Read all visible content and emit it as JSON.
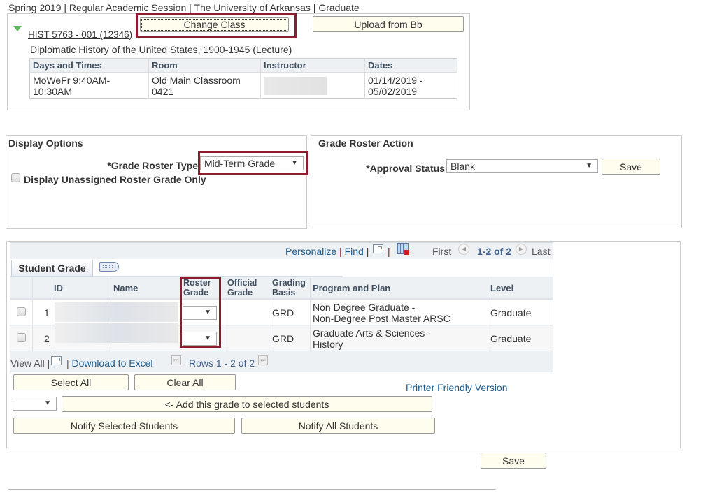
{
  "header": {
    "term_line": "Spring 2019 | Regular Academic Session | The University of Arkansas | Graduate"
  },
  "class_section": {
    "change_class_label": "Change Class",
    "upload_label": "Upload from Bb",
    "class_link": "HIST 5763 - 001 (12346)",
    "class_title": "Diplomatic History of the United States, 1900-1945 (Lecture)",
    "table": {
      "headers": [
        "Days and Times",
        "Room",
        "Instructor",
        "Dates"
      ],
      "row": {
        "days_times": "MoWeFr 9:40AM-10:30AM",
        "room_line1": "Old Main Classroom",
        "room_line2": "0421",
        "instructor": "",
        "dates_line1": "01/14/2019 -",
        "dates_line2": "05/02/2019"
      }
    }
  },
  "display_options": {
    "title": "Display Options",
    "roster_type_label": "*Grade Roster Type",
    "roster_type_value": "Mid-Term Grade",
    "unassigned_label": "Display Unassigned Roster Grade Only",
    "unassigned_checked": false
  },
  "roster_action": {
    "title": "Grade Roster Action",
    "approval_label": "*Approval Status",
    "approval_value": "Blank",
    "save_label": "Save"
  },
  "grid": {
    "toolbar": {
      "personalize": "Personalize",
      "find": "Find",
      "first": "First",
      "count": "1-2 of 2",
      "last": "Last"
    },
    "tab_label": "Student Grade",
    "headers": {
      "id": "ID",
      "name": "Name",
      "roster_grade_1": "Roster",
      "roster_grade_2": "Grade",
      "official_grade_1": "Official",
      "official_grade_2": "Grade",
      "grading_basis_1": "Grading",
      "grading_basis_2": "Basis",
      "program_plan": "Program and Plan",
      "level": "Level"
    },
    "rows": [
      {
        "num": "1",
        "roster_grade": "",
        "official_grade": "",
        "grading_basis": "GRD",
        "program_line1": "Non Degree Graduate -",
        "program_line2": "Non-Degree Post Master ARSC",
        "level": "Graduate"
      },
      {
        "num": "2",
        "roster_grade": "",
        "official_grade": "",
        "grading_basis": "GRD",
        "program_line1": "Graduate Arts & Sciences -",
        "program_line2": "History",
        "level": "Graduate"
      }
    ],
    "footer": {
      "view_all": "View All",
      "download": "Download to Excel",
      "rows": "Rows 1 - 2 of 2"
    }
  },
  "actions": {
    "select_all": "Select All",
    "clear_all": "Clear All",
    "printer_friendly": "Printer Friendly Version",
    "grade_select_value": "",
    "add_grade": "<- Add this grade to selected students",
    "notify_selected": "Notify Selected Students",
    "notify_all": "Notify All Students",
    "save": "Save"
  },
  "colors": {
    "highlight": "#8c1d2f",
    "button_bg": "#fffded",
    "link": "#1c5b8e"
  }
}
